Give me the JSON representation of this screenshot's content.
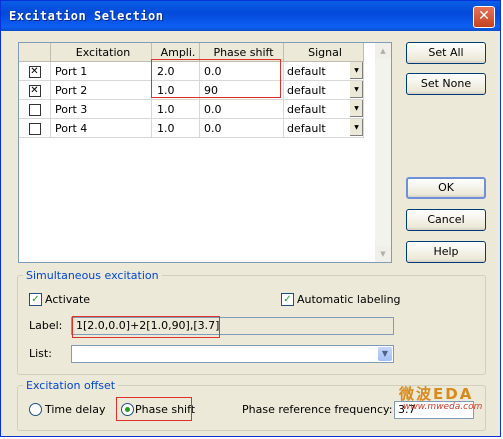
{
  "window": {
    "title": "Excitation Selection",
    "close_glyph": "✕"
  },
  "grid": {
    "headers": [
      "",
      "Excitation",
      "Ampli.",
      "Phase shift",
      "Signal"
    ],
    "rows": [
      {
        "checked": true,
        "mark": "✕",
        "name": "Port 1",
        "ampli": "2.0",
        "phase": "0.0",
        "signal": "default"
      },
      {
        "checked": true,
        "mark": "✕",
        "name": "Port 2",
        "ampli": "1.0",
        "phase": "90",
        "signal": "default"
      },
      {
        "checked": false,
        "mark": "",
        "name": "Port 3",
        "ampli": "1.0",
        "phase": "0.0",
        "signal": "default"
      },
      {
        "checked": false,
        "mark": "",
        "name": "Port 4",
        "ampli": "1.0",
        "phase": "0.0",
        "signal": "default"
      }
    ],
    "dropdown_glyph": "▼",
    "scroll_up": "▲",
    "scroll_down": "▼"
  },
  "buttons": {
    "set_all": "Set All",
    "set_none": "Set None",
    "ok": "OK",
    "cancel": "Cancel",
    "help": "Help"
  },
  "simultaneous": {
    "group_label": "Simultaneous excitation",
    "activate_label": "Activate",
    "activate_checked": true,
    "auto_label": "Automatic labeling",
    "auto_checked": true,
    "check_mark": "✓",
    "label_caption": "Label:",
    "label_value": "1[2.0,0.0]+2[1.0,90],[3.7]",
    "list_caption": "List:",
    "list_value": "",
    "combo_glyph": "▼"
  },
  "offset": {
    "group_label": "Excitation offset",
    "time_delay_label": "Time delay",
    "phase_shift_label": "Phase shift",
    "selected": "phase_shift",
    "ref_freq_label": "Phase reference frequency:",
    "ref_freq_value": "3.7"
  },
  "watermark": {
    "cn": "微波EDA",
    "url": "www.mweda.com"
  },
  "colors": {
    "title_bar": "#0a5ee6",
    "group_label": "#0046d5",
    "highlight": "#e0302a",
    "check": "#21a121"
  }
}
